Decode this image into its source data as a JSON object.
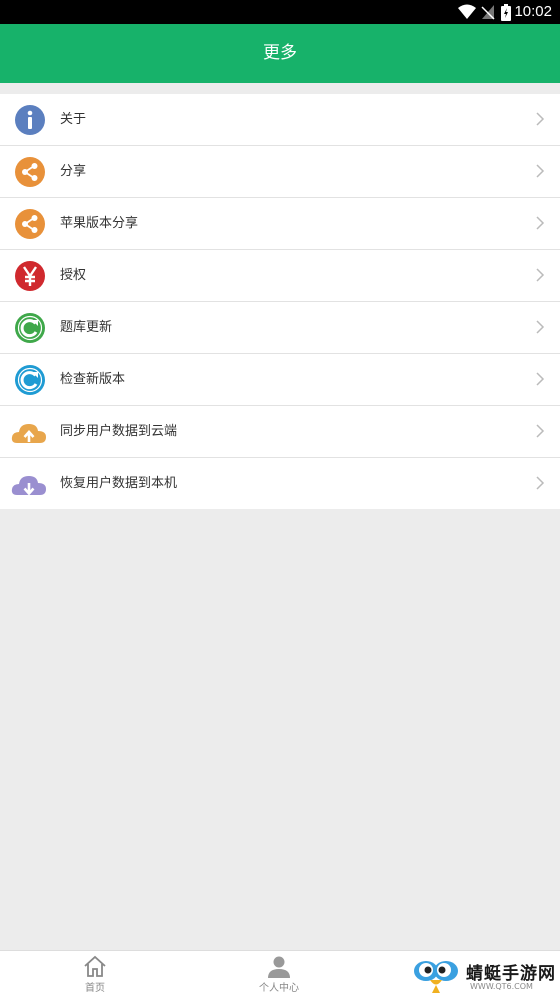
{
  "status": {
    "time": "10:02"
  },
  "header": {
    "title": "更多"
  },
  "menu": [
    {
      "label": "关于",
      "icon": "info-icon",
      "color": "#5b7fbf"
    },
    {
      "label": "分享",
      "icon": "share-icon",
      "color": "#e8913a"
    },
    {
      "label": "苹果版本分享",
      "icon": "share-icon",
      "color": "#e8913a"
    },
    {
      "label": "授权",
      "icon": "yen-icon",
      "color": "#d0292e"
    },
    {
      "label": "题库更新",
      "icon": "refresh-icon",
      "color": "#3fa84a"
    },
    {
      "label": "检查新版本",
      "icon": "refresh-icon",
      "color": "#1f9bd3"
    },
    {
      "label": "同步用户数据到云端",
      "icon": "cloud-upload-icon",
      "color": "#e8a64c"
    },
    {
      "label": "恢复用户数据到本机",
      "icon": "cloud-download-icon",
      "color": "#9a8fd0"
    }
  ],
  "tabs": [
    {
      "label": "首页",
      "icon": "home-icon"
    },
    {
      "label": "个人中心",
      "icon": "person-icon"
    }
  ],
  "watermark": {
    "title": "蜻蜓手游网",
    "url": "WWW.QT6.COM"
  }
}
